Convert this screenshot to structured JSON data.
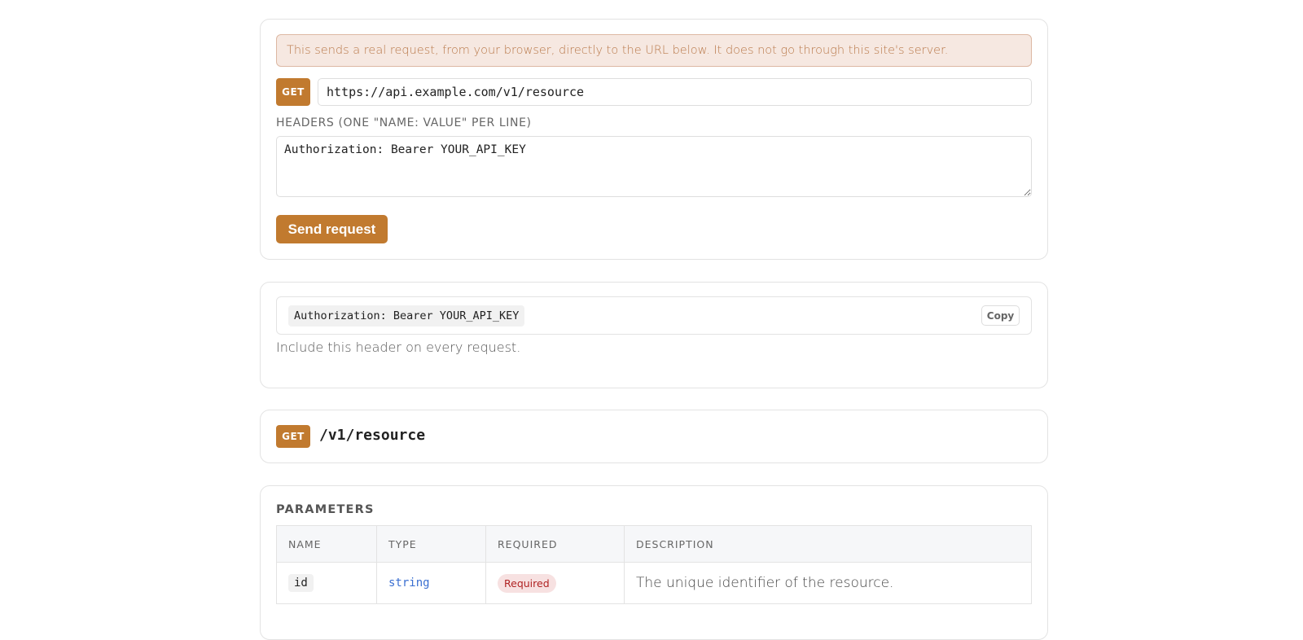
{
  "try_it": {
    "notice": "This sends a real request, from your browser, directly to the URL below. It does not go through this site's server.",
    "method": "GET",
    "url_value": "https://api.example.com/v1/resource",
    "headers_label": "HEADERS (ONE \"NAME: VALUE\" PER LINE)",
    "headers_value": "Authorization: Bearer YOUR_API_KEY",
    "send_label": "Send request"
  },
  "auth": {
    "header_code": "Authorization: Bearer YOUR_API_KEY",
    "copy_label": "Copy",
    "help_text": "Include this header on every request."
  },
  "endpoint": {
    "method": "GET",
    "path": "/v1/resource"
  },
  "parameters": {
    "title": "PARAMETERS",
    "columns": [
      "NAME",
      "TYPE",
      "REQUIRED",
      "DESCRIPTION"
    ],
    "rows": [
      {
        "name": "id",
        "type": "string",
        "required": "Required",
        "description": "The unique identifier of the resource."
      }
    ]
  },
  "colors": {
    "accent": "#c17a2f",
    "notice_bg": "#f6e8e1",
    "required_bg": "#f7e1e1",
    "required_text": "#b02323",
    "type_text": "#3a6fd1"
  }
}
